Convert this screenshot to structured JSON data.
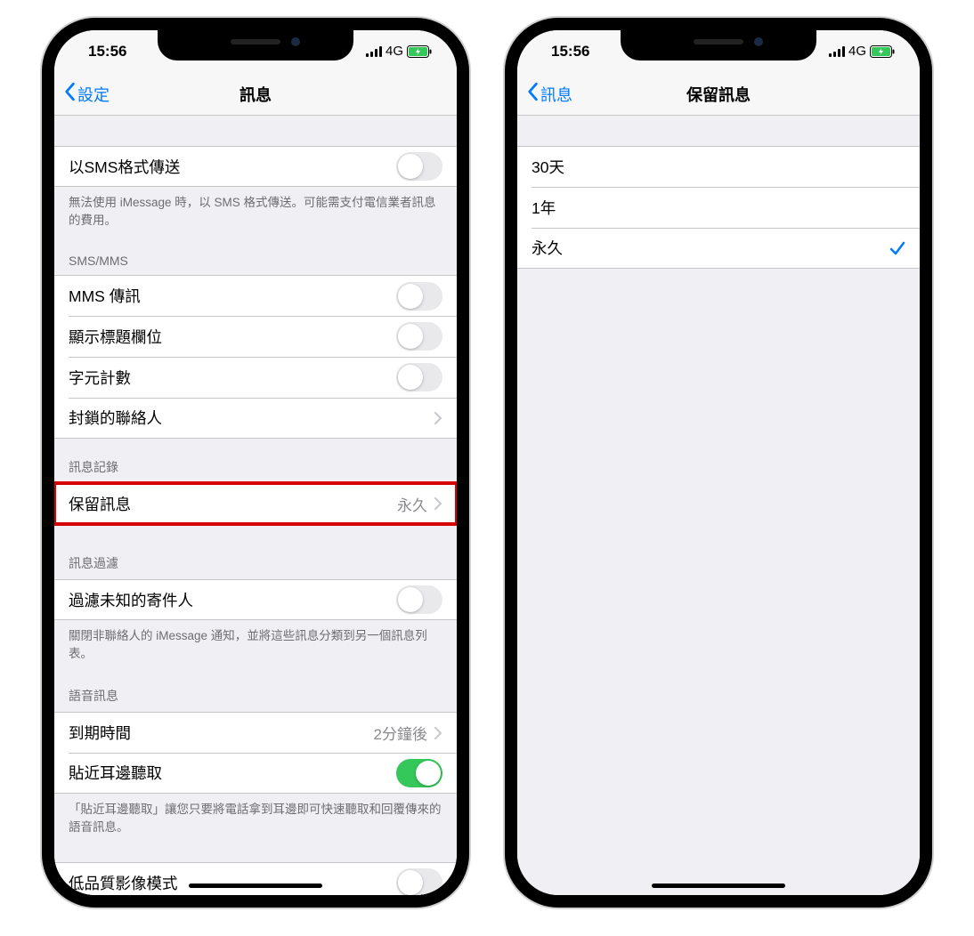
{
  "status": {
    "time": "15:56",
    "network": "4G"
  },
  "left_phone": {
    "back_label": "設定",
    "title": "訊息",
    "rows": {
      "send_as_sms": "以SMS格式傳送",
      "send_as_sms_footer": "無法使用 iMessage 時，以 SMS 格式傳送。可能需支付電信業者訊息的費用。",
      "sms_mms_header": "SMS/MMS",
      "mms_messaging": "MMS 傳訊",
      "show_subject": "顯示標題欄位",
      "char_count": "字元計數",
      "blocked": "封鎖的聯絡人",
      "history_header": "訊息記錄",
      "keep_messages": "保留訊息",
      "keep_messages_value": "永久",
      "filter_header": "訊息過濾",
      "filter_unknown": "過濾未知的寄件人",
      "filter_footer": "關閉非聯絡人的 iMessage 通知，並將這些訊息分類到另一個訊息列表。",
      "audio_header": "語音訊息",
      "expire": "到期時間",
      "expire_value": "2分鐘後",
      "raise_to_listen": "貼近耳邊聽取",
      "raise_footer": "「貼近耳邊聽取」讓您只要將電話拿到耳邊即可快速聽取和回覆傳來的語音訊息。",
      "low_quality": "低品質影像模式"
    }
  },
  "right_phone": {
    "back_label": "訊息",
    "title": "保留訊息",
    "options": {
      "opt_30d": "30天",
      "opt_1y": "1年",
      "opt_forever": "永久"
    }
  }
}
